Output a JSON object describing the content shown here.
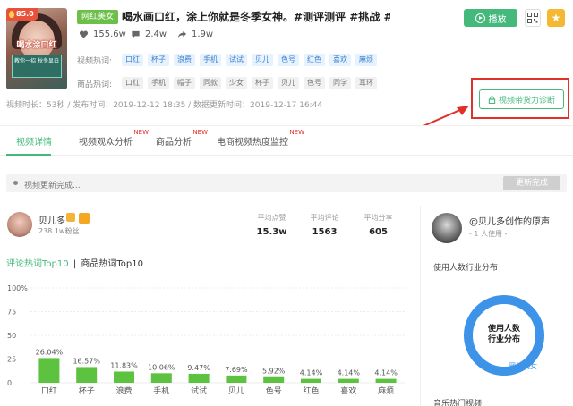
{
  "header": {
    "score": "85.0",
    "thumbnail_caption_top": "喝水涂口红",
    "thumbnail_caption_bottom": "教你一招 秋冬显白",
    "category_tag": "网红美女",
    "title": "喝水画口红，涂上你就是冬季女神。#测评测评 #挑战 #贝...",
    "stats": {
      "likes": "155.6w",
      "comments": "2.4w",
      "shares": "1.9w"
    },
    "video_keywords_label": "视频热词:",
    "video_keywords": [
      "口红",
      "杯子",
      "浪费",
      "手机",
      "试试",
      "贝儿",
      "色号",
      "红色",
      "喜欢",
      "麻烦"
    ],
    "goods_keywords_label": "商品热词:",
    "goods_keywords": [
      "口红",
      "手机",
      "帽子",
      "同款",
      "少女",
      "杯子",
      "贝儿",
      "色号",
      "同学",
      "耳环"
    ],
    "meta": "视频时长：53秒 / 发布时间：2019-12-12 18:35 / 数据更新时间：2019-12-17 16:44",
    "play_label": "播放",
    "diagnose_label": "视频带货力诊断"
  },
  "tabs": [
    {
      "label": "视频详情",
      "new": ""
    },
    {
      "label": "视频观众分析",
      "new": "NEW"
    },
    {
      "label": "商品分析",
      "new": "NEW"
    },
    {
      "label": "电商视频热度监控",
      "new": "NEW"
    }
  ],
  "update": {
    "text": "视频更新完成...",
    "button": "更新完成"
  },
  "author": {
    "name": "贝儿多",
    "fans": "238.1w粉丝",
    "metrics": [
      {
        "label": "平均点赞",
        "value": "15.3w"
      },
      {
        "label": "平均评论",
        "value": "1563"
      },
      {
        "label": "平均分享",
        "value": "605"
      }
    ]
  },
  "chart_tabs": {
    "active": "评论热词Top10",
    "separator": "|",
    "inactive": "商品热词Top10"
  },
  "chart_data": {
    "type": "bar",
    "categories": [
      "口红",
      "杯子",
      "浪费",
      "手机",
      "试试",
      "贝儿",
      "色号",
      "红色",
      "喜欢",
      "麻烦"
    ],
    "values": [
      26.04,
      16.57,
      11.83,
      10.06,
      9.47,
      7.69,
      5.92,
      4.14,
      4.14,
      4.14
    ],
    "data_labels": [
      "26.04%",
      "16.57%",
      "11.83%",
      "10.06%",
      "9.47%",
      "7.69%",
      "5.92%",
      "4.14%",
      "4.14%",
      "4.14%"
    ],
    "yticks": [
      "100%",
      "75",
      "50",
      "25",
      "0"
    ],
    "ylim": [
      0,
      100
    ],
    "grid": true,
    "color": "#5cc23f"
  },
  "right_panel": {
    "music_title": "@贝儿多创作的原声",
    "music_users": "- 1 人使用 -",
    "industry_title": "使用人数行业分布",
    "donut_text_1": "使用人数",
    "donut_text_2": "行业分布",
    "donut_legend": "网红美女",
    "music_hot_title": "音乐热门视频"
  },
  "colors": {
    "accent": "#45b97c",
    "bar": "#5cc23f",
    "annotation": "#e0302a",
    "donut": "#3d93e8"
  }
}
